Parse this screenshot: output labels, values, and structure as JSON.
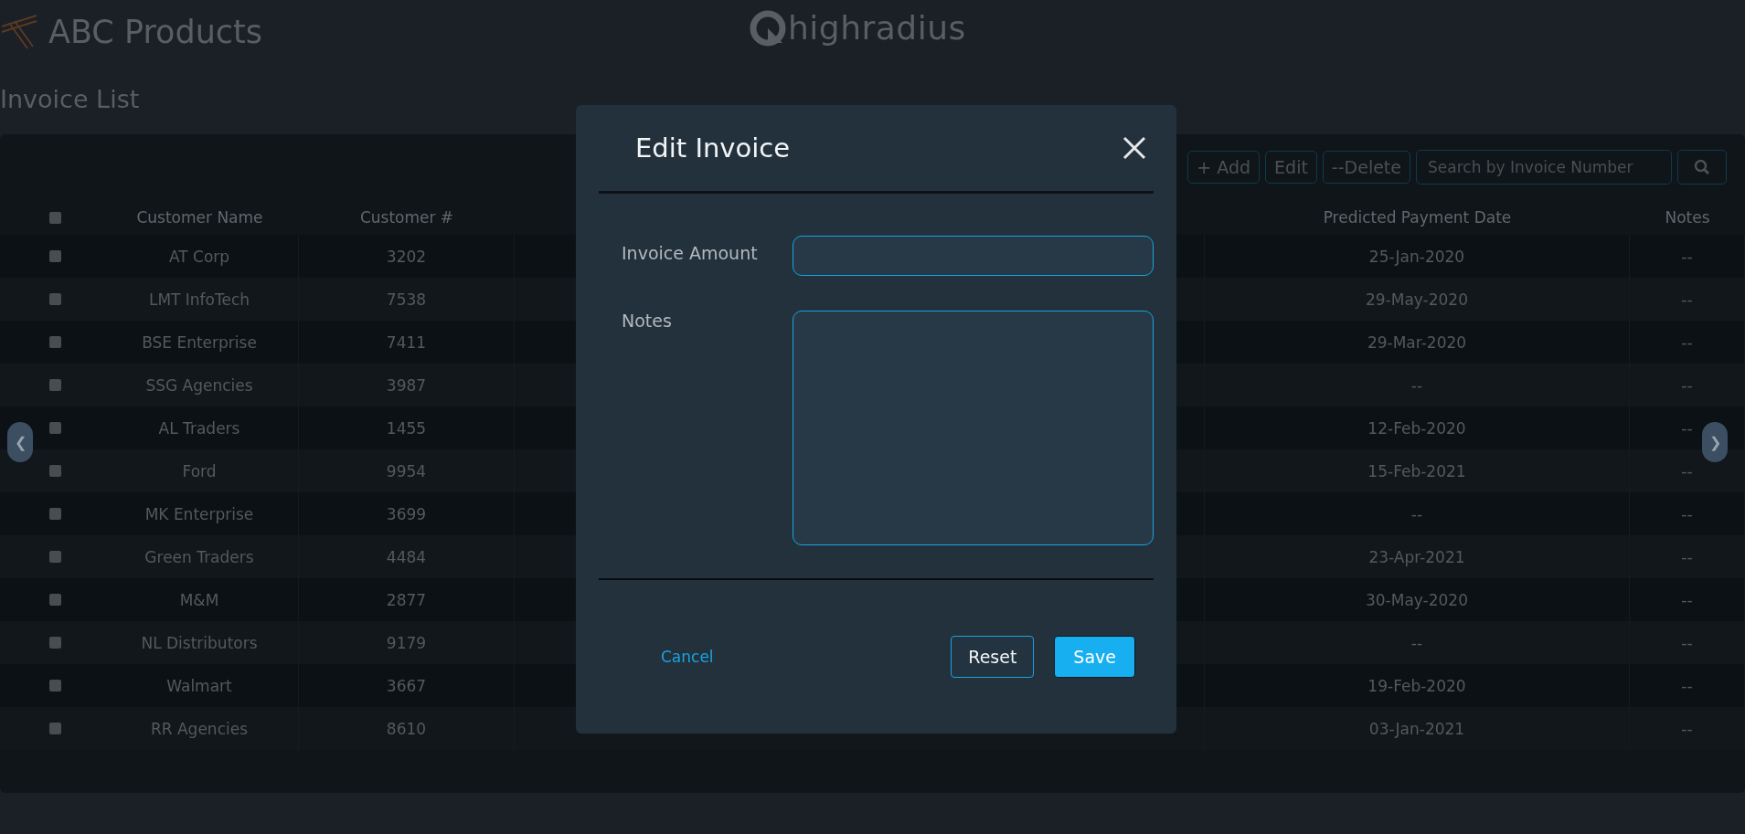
{
  "header": {
    "brand": "ABC Products",
    "partner_logo": "highradius"
  },
  "page_title": "Invoice List",
  "toolbar": {
    "buttons": [
      {
        "label": "+ Add"
      },
      {
        "label": "Edit"
      },
      {
        "label": "--Delete"
      }
    ],
    "search": {
      "placeholder": "Search by Invoice Number"
    }
  },
  "table": {
    "select_all": {
      "checked": false
    },
    "columns": [
      "Customer Name",
      "Customer #",
      "Predicted Payment Date",
      "Notes"
    ],
    "rows": [
      {
        "checked": false,
        "customer_name": "AT Corp",
        "customer_no": "3202",
        "predicted_payment_date": "25-Jan-2020",
        "notes": "--"
      },
      {
        "checked": false,
        "customer_name": "LMT InfoTech",
        "customer_no": "7538",
        "predicted_payment_date": "29-May-2020",
        "notes": "--"
      },
      {
        "checked": false,
        "customer_name": "BSE Enterprise",
        "customer_no": "7411",
        "predicted_payment_date": "29-Mar-2020",
        "notes": "--"
      },
      {
        "checked": false,
        "customer_name": "SSG Agencies",
        "customer_no": "3987",
        "predicted_payment_date": "--",
        "notes": "--"
      },
      {
        "checked": false,
        "customer_name": "AL Traders",
        "customer_no": "1455",
        "predicted_payment_date": "12-Feb-2020",
        "notes": "--"
      },
      {
        "checked": false,
        "customer_name": "Ford",
        "customer_no": "9954",
        "predicted_payment_date": "15-Feb-2021",
        "notes": "--"
      },
      {
        "checked": false,
        "customer_name": "MK Enterprise",
        "customer_no": "3699",
        "predicted_payment_date": "--",
        "notes": "--"
      },
      {
        "checked": false,
        "customer_name": "Green Traders",
        "customer_no": "4484",
        "predicted_payment_date": "23-Apr-2021",
        "notes": "--"
      },
      {
        "checked": false,
        "customer_name": "M&M",
        "customer_no": "2877",
        "predicted_payment_date": "30-May-2020",
        "notes": "--"
      },
      {
        "checked": false,
        "customer_name": "NL Distributors",
        "customer_no": "9179",
        "predicted_payment_date": "--",
        "notes": "--"
      },
      {
        "checked": false,
        "customer_name": "Walmart",
        "customer_no": "3667",
        "predicted_payment_date": "19-Feb-2020",
        "notes": "--"
      },
      {
        "checked": false,
        "customer_name": "RR Agencies",
        "customer_no": "8610",
        "predicted_payment_date": "03-Jan-2021",
        "notes": "--"
      }
    ]
  },
  "pager": {
    "prev": "❮",
    "next": "❯"
  },
  "dialog": {
    "title": "Edit Invoice",
    "fields": [
      {
        "kind": "input",
        "label": "Invoice Amount"
      },
      {
        "kind": "textarea",
        "label": "Notes"
      }
    ],
    "actions": [
      {
        "kind": "link",
        "label": "Cancel"
      },
      {
        "kind": "outline",
        "label": "Reset"
      },
      {
        "kind": "primary",
        "label": "Save"
      }
    ]
  }
}
